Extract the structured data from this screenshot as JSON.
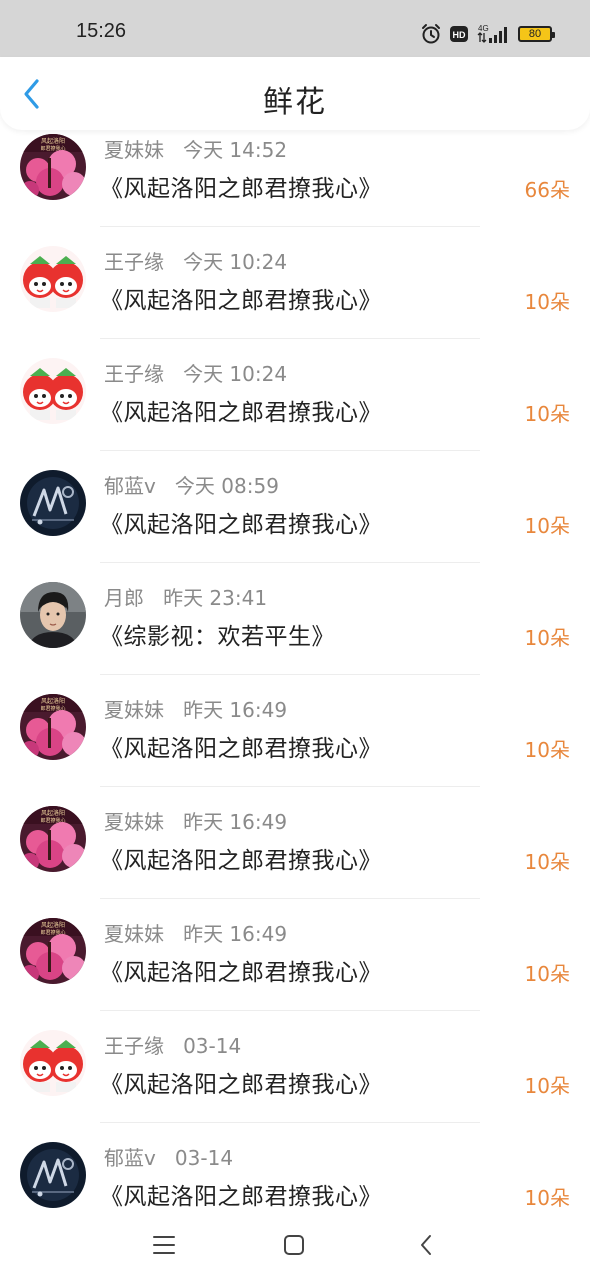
{
  "status_bar": {
    "time": "15:26",
    "battery": "80",
    "network": "4G",
    "icons": [
      "alarm-icon",
      "hd-icon",
      "signal-icon",
      "battery-icon"
    ]
  },
  "header": {
    "title": "鲜花",
    "back_icon": "chevron-left-icon"
  },
  "colors": {
    "accent_blue": "#2f9be6",
    "count_orange": "#e8873c",
    "meta_gray": "#8a8a8a"
  },
  "items": [
    {
      "user": "夏妹妹",
      "time": "今天 14:52",
      "book": "《风起洛阳之郎君撩我心》",
      "count": "66朵",
      "avatar": "pink-blossom-avatar"
    },
    {
      "user": "王子缘",
      "time": "今天 10:24",
      "book": "《风起洛阳之郎君撩我心》",
      "count": "10朵",
      "avatar": "strawberry-cartoon-avatar"
    },
    {
      "user": "王子缘",
      "time": "今天 10:24",
      "book": "《风起洛阳之郎君撩我心》",
      "count": "10朵",
      "avatar": "strawberry-cartoon-avatar"
    },
    {
      "user": "郁蓝v",
      "time": "今天 08:59",
      "book": "《风起洛阳之郎君撩我心》",
      "count": "10朵",
      "avatar": "dark-blue-logo-avatar"
    },
    {
      "user": "月郎",
      "time": "昨天 23:41",
      "book": "《综影视：欢若平生》",
      "count": "10朵",
      "avatar": "man-portrait-avatar"
    },
    {
      "user": "夏妹妹",
      "time": "昨天 16:49",
      "book": "《风起洛阳之郎君撩我心》",
      "count": "10朵",
      "avatar": "pink-blossom-avatar"
    },
    {
      "user": "夏妹妹",
      "time": "昨天 16:49",
      "book": "《风起洛阳之郎君撩我心》",
      "count": "10朵",
      "avatar": "pink-blossom-avatar"
    },
    {
      "user": "夏妹妹",
      "time": "昨天 16:49",
      "book": "《风起洛阳之郎君撩我心》",
      "count": "10朵",
      "avatar": "pink-blossom-avatar"
    },
    {
      "user": "王子缘",
      "time": "03-14",
      "book": "《风起洛阳之郎君撩我心》",
      "count": "10朵",
      "avatar": "strawberry-cartoon-avatar"
    },
    {
      "user": "郁蓝v",
      "time": "03-14",
      "book": "《风起洛阳之郎君撩我心》",
      "count": "10朵",
      "avatar": "dark-blue-logo-avatar"
    }
  ],
  "nav_bar": {
    "buttons": [
      "menu-icon",
      "home-icon",
      "back-icon"
    ]
  }
}
